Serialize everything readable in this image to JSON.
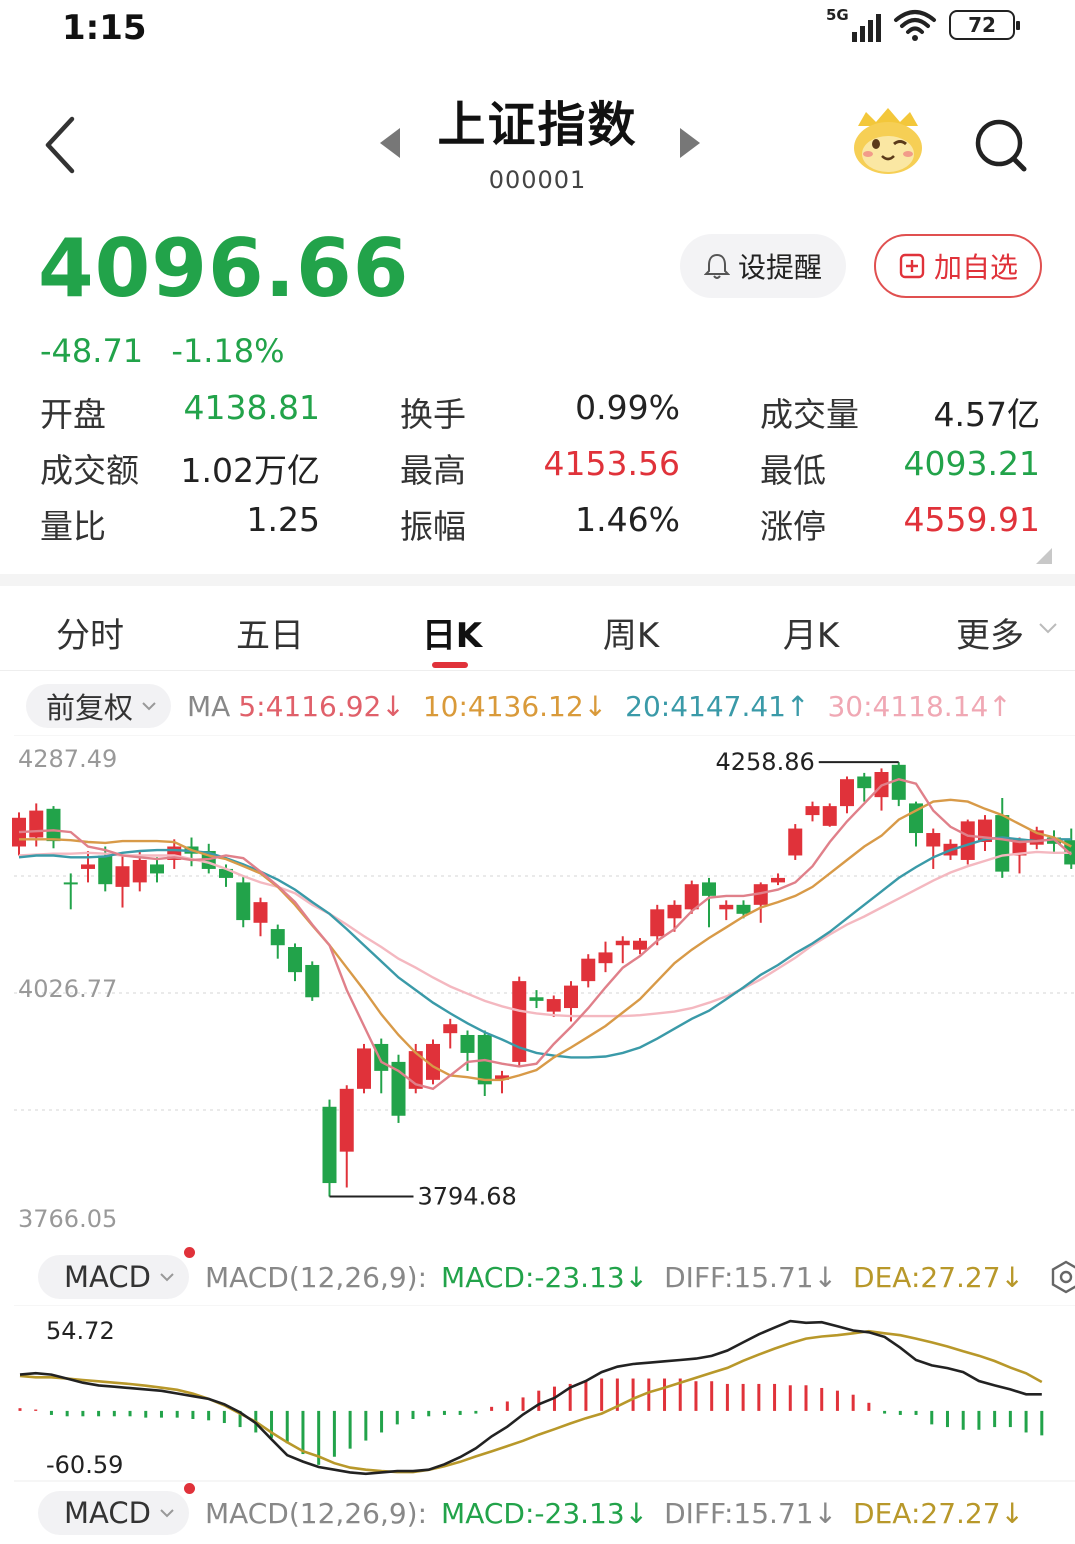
{
  "status_bar": {
    "time": "1:15",
    "network": "5G",
    "battery": "72"
  },
  "nav": {
    "title": "上证指数",
    "code": "000001"
  },
  "quote": {
    "price": "4096.66",
    "change": "-48.71",
    "change_pct": "-1.18%"
  },
  "actions": {
    "alert_label": "设提醒",
    "watchlist_label": "加自选"
  },
  "stats": [
    [
      {
        "label": "开盘",
        "value": "4138.81",
        "color": "#22a34a"
      },
      {
        "label": "换手",
        "value": "0.99%",
        "color": "#222222"
      },
      {
        "label": "成交量",
        "value": "4.57亿",
        "color": "#222222"
      }
    ],
    [
      {
        "label": "成交额",
        "value": "1.02万亿",
        "color": "#222222"
      },
      {
        "label": "最高",
        "value": "4153.56",
        "color": "#e0323a"
      },
      {
        "label": "最低",
        "value": "4093.21",
        "color": "#22a34a"
      }
    ],
    [
      {
        "label": "量比",
        "value": "1.25",
        "color": "#222222"
      },
      {
        "label": "振幅",
        "value": "1.46%",
        "color": "#222222"
      },
      {
        "label": "涨停",
        "value": "4559.91",
        "color": "#e0323a"
      }
    ]
  ],
  "tabs": [
    {
      "label": "分时"
    },
    {
      "label": "五日"
    },
    {
      "label": "日K",
      "active": true
    },
    {
      "label": "周K"
    },
    {
      "label": "月K"
    },
    {
      "label": "更多"
    }
  ],
  "indicators": {
    "adjust_label": "前复权",
    "ma_prefix": "MA",
    "ma": [
      {
        "text": "5:4116.92↓",
        "color": "#e0606a"
      },
      {
        "text": "10:4136.12↓",
        "color": "#d99a3a"
      },
      {
        "text": "20:4147.41↑",
        "color": "#3a9aa8"
      },
      {
        "text": "30:4118.14↑",
        "color": "#f0a8b4"
      }
    ]
  },
  "colors": {
    "up": "#e0323a",
    "down": "#22a34a",
    "ma5": "#e0808a",
    "ma10": "#d89a48",
    "ma20": "#3a9aa8",
    "ma30": "#f4b8c0",
    "diff": "#222222",
    "dea": "#b8982a"
  },
  "chart_data": [
    {
      "type": "candlestick",
      "ylim": [
        3766.05,
        4287.49
      ],
      "y_ticks": [
        "4287.49",
        "4026.77",
        "3766.05"
      ],
      "high_label": "4258.86",
      "low_label": "3794.68",
      "candles": [
        [
          4190,
          4222,
          4180,
          4228
        ],
        [
          4200,
          4230,
          4190,
          4238
        ],
        [
          4232,
          4196,
          4188,
          4235
        ],
        [
          4150,
          4148,
          4120,
          4160
        ],
        [
          4165,
          4170,
          4150,
          4185
        ],
        [
          4180,
          4148,
          4140,
          4190
        ],
        [
          4145,
          4168,
          4122,
          4180
        ],
        [
          4150,
          4175,
          4140,
          4185
        ],
        [
          4170,
          4160,
          4150,
          4178
        ],
        [
          4175,
          4190,
          4165,
          4198
        ],
        [
          4190,
          4182,
          4168,
          4200
        ],
        [
          4185,
          4165,
          4160,
          4193
        ],
        [
          4165,
          4155,
          4145,
          4170
        ],
        [
          4150,
          4108,
          4100,
          4158
        ],
        [
          4105,
          4128,
          4090,
          4133
        ],
        [
          4098,
          4080,
          4065,
          4103
        ],
        [
          4078,
          4050,
          4040,
          4082
        ],
        [
          4058,
          4022,
          4018,
          4062
        ],
        [
          3900,
          3815,
          3800,
          3908
        ],
        [
          3850,
          3920,
          3810,
          3924
        ],
        [
          3920,
          3965,
          3915,
          3970
        ],
        [
          3970,
          3940,
          3915,
          3976
        ],
        [
          3950,
          3890,
          3882,
          3958
        ],
        [
          3920,
          3962,
          3915,
          3970
        ],
        [
          3930,
          3970,
          3925,
          3975
        ],
        [
          3982,
          3992,
          3965,
          3998
        ],
        [
          3980,
          3960,
          3940,
          3985
        ],
        [
          3980,
          3925,
          3912,
          3985
        ],
        [
          3930,
          3935,
          3915,
          3940
        ],
        [
          3950,
          4040,
          3945,
          4045
        ],
        [
          4022,
          4018,
          4010,
          4030
        ],
        [
          4006,
          4020,
          4000,
          4024
        ],
        [
          4010,
          4035,
          3995,
          4040
        ],
        [
          4040,
          4065,
          4033,
          4070
        ],
        [
          4060,
          4072,
          4050,
          4084
        ],
        [
          4080,
          4085,
          4060,
          4090
        ],
        [
          4075,
          4085,
          4070,
          4088
        ],
        [
          4090,
          4120,
          4080,
          4125
        ],
        [
          4110,
          4125,
          4095,
          4130
        ],
        [
          4120,
          4148,
          4115,
          4152
        ],
        [
          4150,
          4135,
          4100,
          4155
        ],
        [
          4120,
          4125,
          4108,
          4130
        ],
        [
          4125,
          4115,
          4110,
          4130
        ],
        [
          4125,
          4148,
          4105,
          4150
        ],
        [
          4150,
          4155,
          4147,
          4160
        ],
        [
          4180,
          4210,
          4175,
          4215
        ],
        [
          4225,
          4235,
          4218,
          4240
        ],
        [
          4213,
          4235,
          4212,
          4238
        ],
        [
          4235,
          4265,
          4227,
          4268
        ],
        [
          4268,
          4255,
          4240,
          4272
        ],
        [
          4245,
          4273,
          4230,
          4277
        ],
        [
          4281,
          4242,
          4235,
          4284
        ],
        [
          4238,
          4205,
          4190,
          4240
        ],
        [
          4190,
          4205,
          4165,
          4210
        ],
        [
          4180,
          4193,
          4175,
          4198
        ],
        [
          4175,
          4218,
          4170,
          4220
        ],
        [
          4195,
          4220,
          4185,
          4225
        ],
        [
          4225,
          4162,
          4155,
          4244
        ],
        [
          4180,
          4198,
          4160,
          4200
        ],
        [
          4192,
          4208,
          4187,
          4212
        ],
        [
          4200,
          4193,
          4182,
          4208
        ],
        [
          4197,
          4170,
          4165,
          4210
        ]
      ],
      "ma5": [
        4206,
        4207,
        4208,
        4206,
        4190,
        4186,
        4180,
        4178,
        4176,
        4178,
        4175,
        4176,
        4180,
        4177,
        4162,
        4146,
        4128,
        4103,
        4080,
        4030,
        3990,
        3950,
        3940,
        3925,
        3920,
        3935,
        3950,
        3952,
        3948,
        3945,
        3948,
        3970,
        3989,
        4010,
        4033,
        4055,
        4068,
        4085,
        4098,
        4118,
        4133,
        4135,
        4135,
        4138,
        4142,
        4150,
        4168,
        4195,
        4218,
        4238,
        4258,
        4265,
        4260,
        4230,
        4212,
        4202,
        4200,
        4198,
        4195,
        4196,
        4198,
        4181
      ],
      "ma10": [
        4198,
        4198,
        4198,
        4197,
        4195,
        4194,
        4196,
        4196,
        4196,
        4195,
        4186,
        4180,
        4176,
        4168,
        4160,
        4145,
        4125,
        4102,
        4080,
        4055,
        4030,
        4003,
        3980,
        3960,
        3945,
        3935,
        3933,
        3930,
        3930,
        3935,
        3941,
        3955,
        3966,
        3978,
        3990,
        4005,
        4020,
        4040,
        4060,
        4075,
        4088,
        4100,
        4112,
        4122,
        4128,
        4135,
        4145,
        4160,
        4175,
        4190,
        4202,
        4220,
        4230,
        4240,
        4242,
        4240,
        4232,
        4225,
        4215,
        4205,
        4200,
        4190
      ],
      "ma20": [
        4178,
        4180,
        4180,
        4178,
        4178,
        4179,
        4183,
        4185,
        4186,
        4186,
        4185,
        4183,
        4177,
        4170,
        4162,
        4153,
        4142,
        4128,
        4115,
        4098,
        4080,
        4062,
        4044,
        4030,
        4016,
        4004,
        3993,
        3983,
        3975,
        3966,
        3960,
        3957,
        3955,
        3955,
        3956,
        3960,
        3966,
        3976,
        3987,
        3998,
        4007,
        4020,
        4033,
        4047,
        4058,
        4071,
        4082,
        4095,
        4110,
        4125,
        4140,
        4155,
        4167,
        4178,
        4186,
        4192,
        4198,
        4200,
        4198,
        4196,
        4198,
        4198
      ],
      "ma30": [
        4180,
        4181,
        4182,
        4182,
        4183,
        4182,
        4180,
        4180,
        4180,
        4180,
        4176,
        4172,
        4165,
        4157,
        4150,
        4145,
        4138,
        4125,
        4115,
        4103,
        4090,
        4078,
        4065,
        4055,
        4044,
        4034,
        4026,
        4018,
        4012,
        4007,
        4004,
        4002,
        4001,
        4001,
        4001,
        4001,
        4002,
        4004,
        4006,
        4010,
        4016,
        4023,
        4032,
        4042,
        4054,
        4066,
        4080,
        4092,
        4103,
        4112,
        4122,
        4132,
        4142,
        4152,
        4161,
        4168,
        4174,
        4180,
        4182,
        4184,
        4183,
        4183
      ]
    },
    {
      "type": "bar+line",
      "name": "MACD",
      "label": "MACD",
      "params": "MACD(12,26,9):",
      "macd_text": "MACD:-23.13↓",
      "diff_text": "DIFF:15.71↓",
      "dea_text": "DEA:27.27↓",
      "ylim": [
        -60.59,
        54.72
      ],
      "y_ticks": [
        "54.72",
        "-60.59"
      ],
      "macd": [
        2.55,
        1.28,
        -3.83,
        -5.1,
        -5.1,
        -5.1,
        -5.1,
        -5.1,
        -6.37,
        -6.37,
        -6.37,
        -7.65,
        -8.92,
        -11.47,
        -15.3,
        -20.39,
        -25.49,
        -30.59,
        -40.79,
        -50.99,
        -43.34,
        -35.69,
        -28.04,
        -20.39,
        -12.75,
        -7.65,
        -5.1,
        -3.83,
        -3.83,
        -2.55,
        3.83,
        8.92,
        12.75,
        19.12,
        22.95,
        25.49,
        28.04,
        30.59,
        30.59,
        30.59,
        30.59,
        30.59,
        30.59,
        28.04,
        28.04,
        25.49,
        25.49,
        25.49,
        25.49,
        24.22,
        24.22,
        21.67,
        19.12,
        15.3,
        7.65,
        -2.55,
        -3.83,
        -3.83,
        -12.75,
        -15.3,
        -17.84,
        -17.84,
        -15.3,
        -15.3,
        -20.39,
        -23.13
      ],
      "diff": [
        34.32,
        35.59,
        34.32,
        30.49,
        26.67,
        24.12,
        22.84,
        21.57,
        20.29,
        19.02,
        16.47,
        13.92,
        11.37,
        6.27,
        -1.38,
        -11.58,
        -26.88,
        -41.83,
        -47.94,
        -53.04,
        -55.59,
        -58.14,
        -59.42,
        -58.14,
        -56.86,
        -56.86,
        -55.59,
        -50.49,
        -43.69,
        -35.34,
        -24.14,
        -14.94,
        -3.42,
        6.27,
        12.26,
        22.11,
        28.24,
        36.66,
        41.76,
        44.31,
        45.59,
        46.86,
        48.14,
        49.43,
        51.96,
        57.06,
        64.71,
        72.36,
        78.73,
        84.84,
        83.23,
        83.86,
        80.03,
        75.97,
        74.28,
        69.93,
        59.76,
        48.14,
        43.04,
        40.49,
        36.66,
        28.24,
        24.12,
        20.29,
        15.71,
        15.71
      ],
      "dea": [
        33.04,
        31.77,
        31.77,
        30.49,
        29.22,
        27.94,
        26.67,
        25.39,
        23.86,
        21.96,
        19.93,
        16.35,
        11.46,
        5.22,
        -2.55,
        -10.2,
        -20.39,
        -29.64,
        -38.11,
        -43.06,
        -49.42,
        -53.57,
        -55.59,
        -56.86,
        -57.89,
        -57.89,
        -55.79,
        -52.25,
        -48.14,
        -42.98,
        -38.27,
        -33.3,
        -28.29,
        -22.39,
        -17.29,
        -11.95,
        -6.88,
        -2.55,
        4.39,
        11.57,
        17.62,
        21.95,
        26.56,
        31.26,
        35.98,
        40.6,
        47.34,
        53.24,
        58.89,
        63.93,
        68.3,
        70.34,
        71.5,
        73.37,
        75.33,
        73.37,
        71.5,
        68.3,
        64.71,
        60.88,
        56.36,
        52.16,
        47.18,
        40.92,
        35.5,
        27.27
      ]
    }
  ],
  "macd_bottom": {
    "label": "MACD",
    "params": "MACD(12,26,9):",
    "macd_text": "MACD:-23.13↓",
    "diff_text": "DIFF:15.71↓",
    "dea_text": "DEA:27.27↓"
  }
}
